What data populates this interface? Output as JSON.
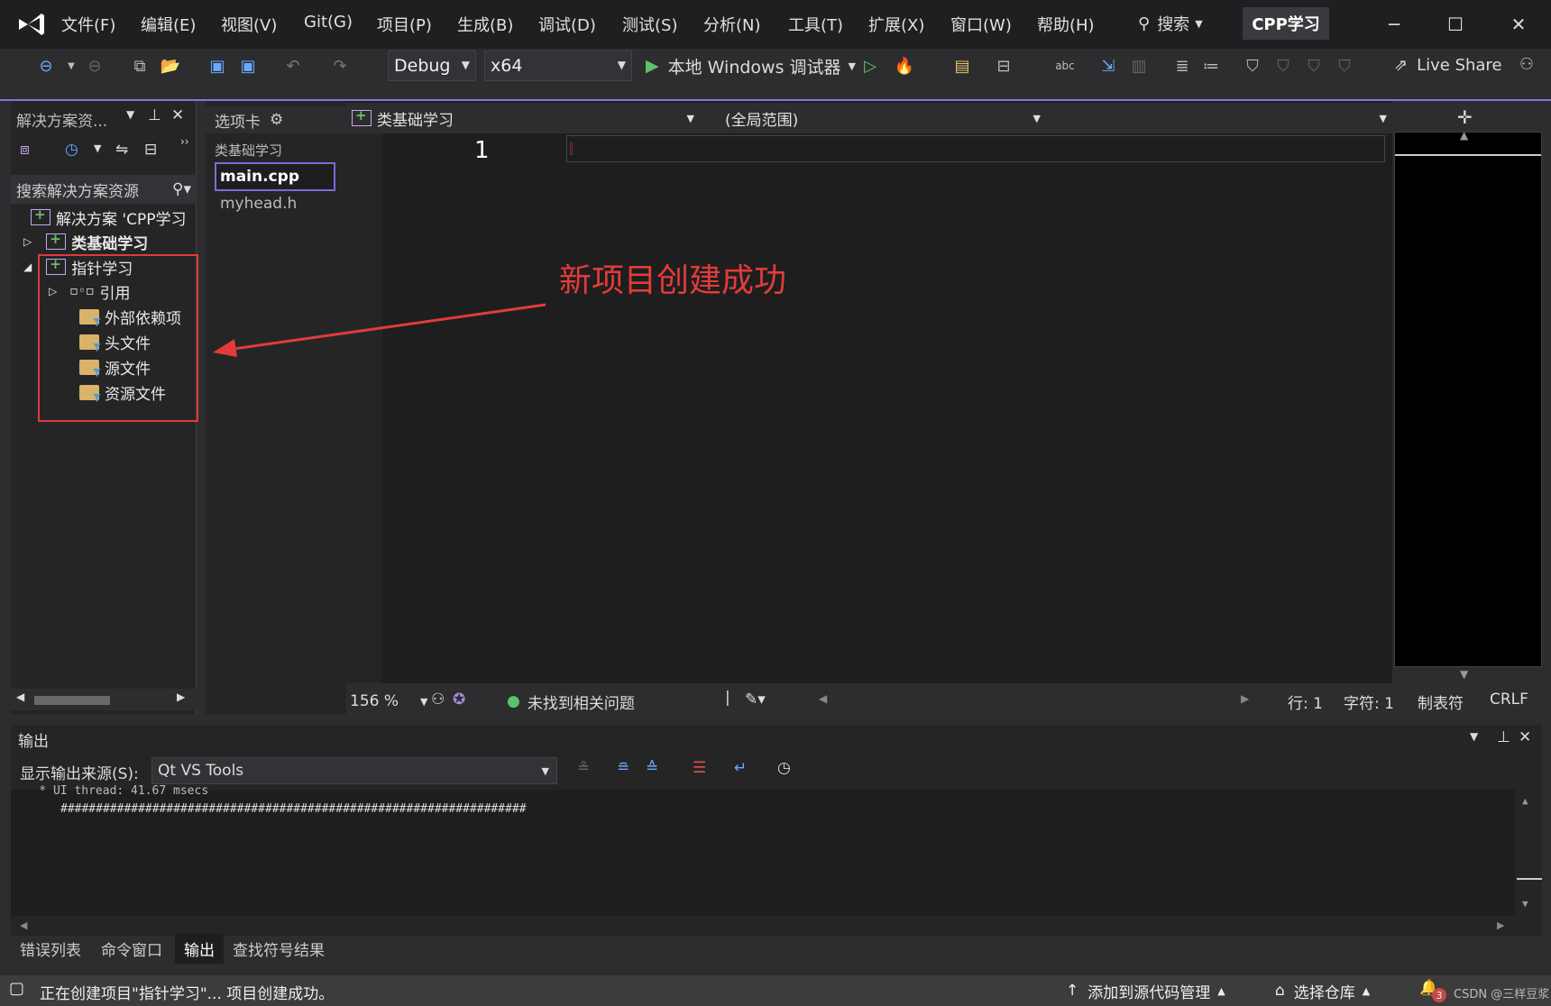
{
  "menubar": {
    "items": [
      "文件(F)",
      "编辑(E)",
      "视图(V)",
      "Git(G)",
      "项目(P)",
      "生成(B)",
      "调试(D)",
      "测试(S)",
      "分析(N)",
      "工具(T)",
      "扩展(X)",
      "窗口(W)",
      "帮助(H)"
    ],
    "search_label": "搜索",
    "solution_title": "CPP学习"
  },
  "toolbar": {
    "config": "Debug",
    "platform": "x64",
    "debugger_label": "本地 Windows 调试器",
    "live_share": "Live Share"
  },
  "solution_explorer": {
    "title": "解决方案资...",
    "search_placeholder": "搜索解决方案资源",
    "tree": {
      "solution": "解决方案 'CPP学习",
      "project1": "类基础学习",
      "project2": "指针学习",
      "refs": "引用",
      "external": "外部依赖项",
      "headers": "头文件",
      "sources": "源文件",
      "resources": "资源文件"
    }
  },
  "tabs_pane": {
    "title": "选项卡",
    "group": "类基础学习",
    "files": [
      "main.cpp",
      "myhead.h"
    ]
  },
  "editor": {
    "nav_project": "类基础学习",
    "nav_scope": "(全局范围)",
    "line_number": "1",
    "zoom": "156 %",
    "issues": "未找到相关问题",
    "line": "行: 1",
    "col": "字符: 1",
    "tabs": "制表符",
    "eol": "CRLF"
  },
  "output": {
    "title": "输出",
    "source_label": "显示输出来源(S):",
    "source_value": "Qt VS Tools",
    "lines": [
      "    * UI thread: 41.67 msecs",
      "##################################################################"
    ]
  },
  "bottom_tabs": [
    "错误列表",
    "命令窗口",
    "输出",
    "查找符号结果"
  ],
  "statusbar": {
    "message": "正在创建项目\"指针学习\"... 项目创建成功。",
    "add_source": "添加到源代码管理",
    "select_repo": "选择仓库",
    "notifications": "3",
    "watermark": "CSDN @三样豆浆"
  },
  "annotation": {
    "text": "新项目创建成功"
  }
}
